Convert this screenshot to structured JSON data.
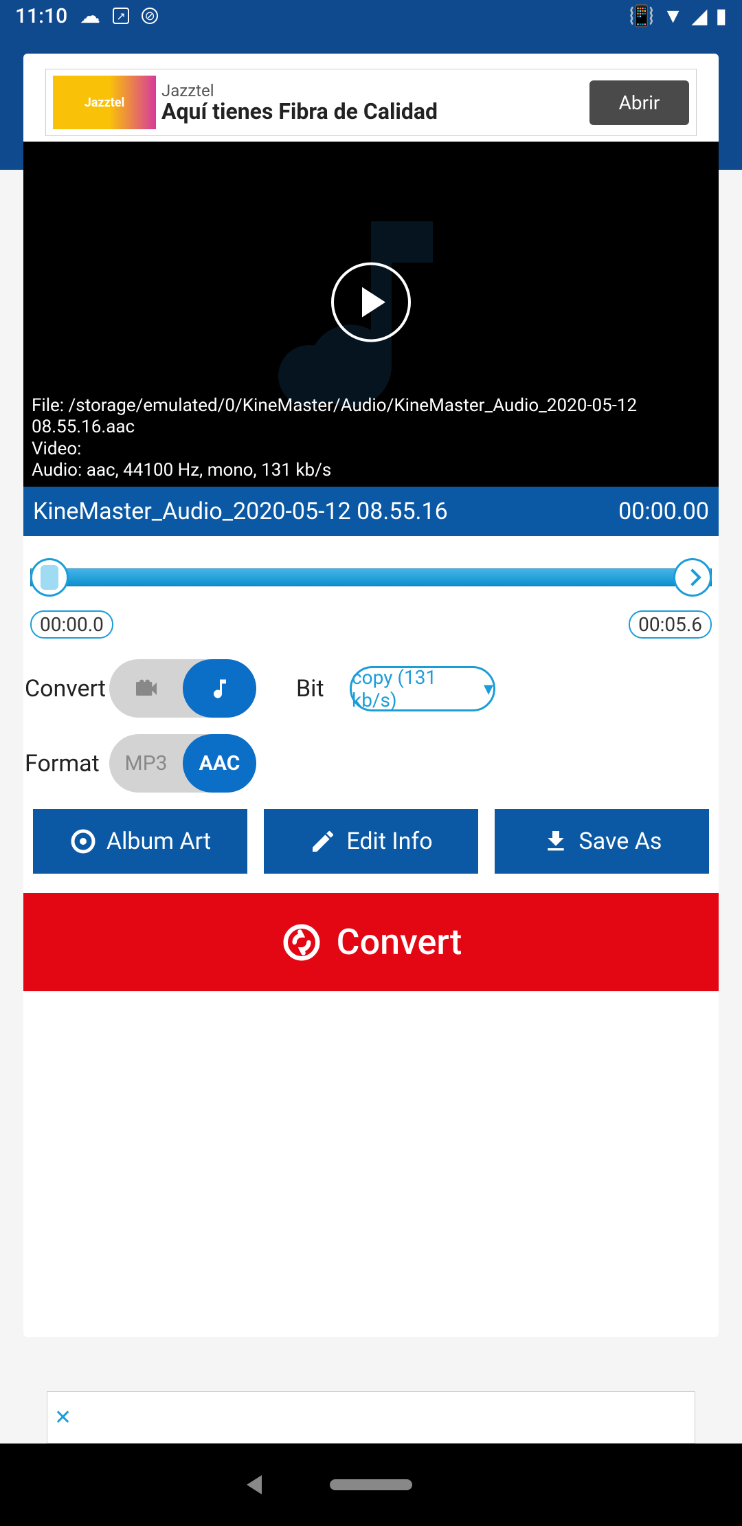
{
  "status": {
    "time": "11:10"
  },
  "ad": {
    "brand": "Jazztel",
    "headline": "Aquí tienes Fibra de Calidad",
    "cta": "Abrir",
    "logo_text": "Jazztel"
  },
  "player": {
    "file_line": "File: /storage/emulated/0/KineMaster/Audio/KineMaster_Audio_2020-05-12 08.55.16.aac",
    "video_line": "Video:",
    "audio_line": "Audio: aac,  44100 Hz,  mono, 131 kb/s"
  },
  "title_bar": {
    "filename": "KineMaster_Audio_2020-05-12 08.55.16",
    "timecode": "00:00.00"
  },
  "seek": {
    "start": "00:00.0",
    "end": "00:05.6"
  },
  "controls": {
    "convert_label": "Convert",
    "bit_label": "Bit",
    "bit_value": "copy (131 kb/s)",
    "format_label": "Format",
    "format_opt_a": "MP3",
    "format_opt_b": "AAC"
  },
  "actions": {
    "album_art": "Album Art",
    "edit_info": "Edit Info",
    "save_as": "Save As",
    "convert": "Convert"
  }
}
